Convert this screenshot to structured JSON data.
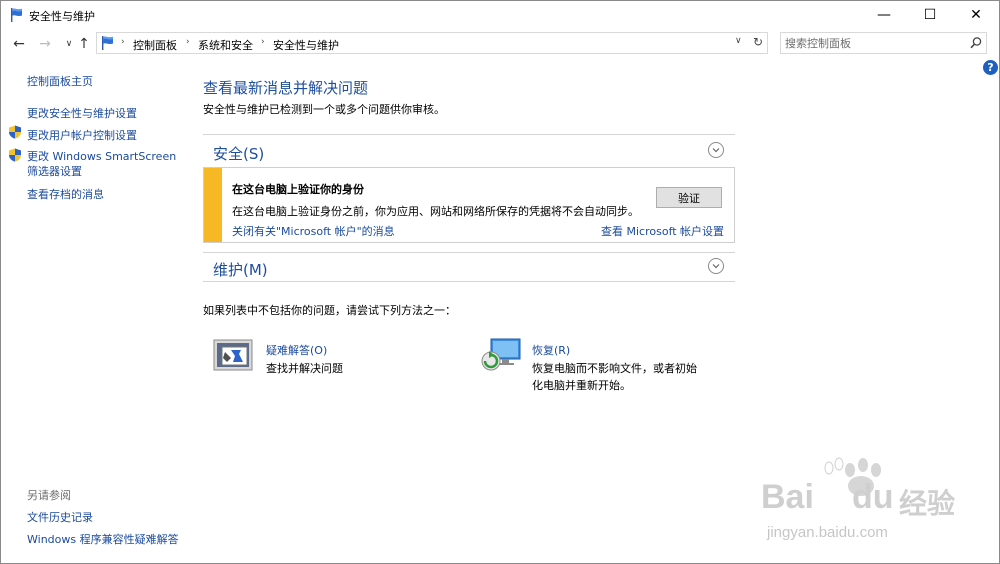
{
  "window": {
    "title": "安全性与维护",
    "minimize": "—",
    "maximize": "☐",
    "close": "✕"
  },
  "nav": {
    "back": "←",
    "forward": "→",
    "recent": "∨",
    "up": "↑",
    "breadcrumb": [
      "控制面板",
      "系统和安全",
      "安全性与维护"
    ],
    "separator": "›",
    "dropdown": "∨",
    "refresh": "↻",
    "search_placeholder": "搜索控制面板"
  },
  "help": "?",
  "sidebar": {
    "home": "控制面板主页",
    "links": [
      "更改安全性与维护设置",
      "更改用户帐户控制设置",
      "更改 Windows SmartScreen 筛选器设置",
      "查看存档的消息"
    ],
    "see_also_label": "另请参阅",
    "see_also": [
      "文件历史记录",
      "Windows 程序兼容性疑难解答"
    ]
  },
  "main": {
    "title": "查看最新消息并解决问题",
    "subtitle": "安全性与维护已检测到一个或多个问题供你审核。",
    "security": {
      "title": "安全(S)",
      "alert": {
        "title": "在这台电脑上验证你的身份",
        "description": "在这台电脑上验证身份之前，你为应用、网站和网络所保存的凭据将不会自动同步。",
        "button": "验证",
        "link_dismiss": "关闭有关\"Microsoft 帐户\"的消息",
        "link_settings": "查看 Microsoft 帐户设置",
        "accent_color": "#f6b825"
      }
    },
    "maintenance": {
      "title": "维护(M)"
    },
    "try_text": "如果列表中不包括你的问题，请尝试下列方法之一：",
    "tools": [
      {
        "label": "疑难解答(O)",
        "description": "查找并解决问题"
      },
      {
        "label": "恢复(R)",
        "description": "恢复电脑而不影响文件，或者初始化电脑并重新开始。"
      }
    ]
  },
  "watermark": {
    "brand": "Bai",
    "brand2": "du",
    "cn": "经验",
    "url": "jingyan.baidu.com"
  },
  "colors": {
    "link": "#1a4a9c",
    "heading": "#1e4e9e",
    "help": "#1e5fc1"
  }
}
